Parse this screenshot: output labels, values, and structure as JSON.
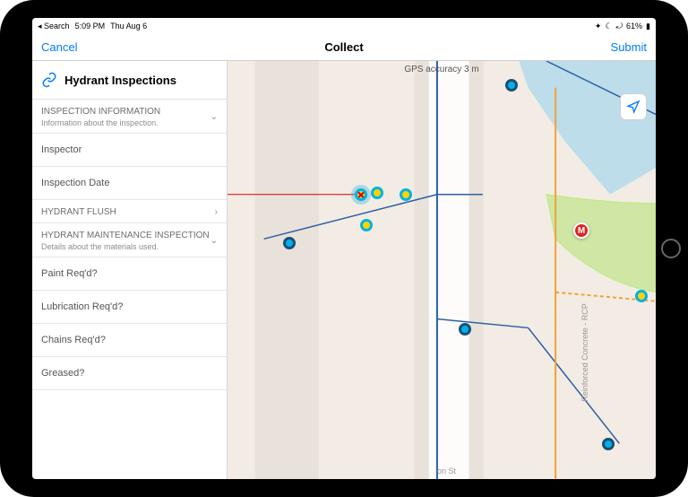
{
  "status": {
    "search": "Search",
    "time": "5:09 PM",
    "date": "Thu Aug 6",
    "battery": "61%"
  },
  "nav": {
    "cancel": "Cancel",
    "title": "Collect",
    "submit": "Submit"
  },
  "form": {
    "title": "Hydrant Inspections",
    "sections": [
      {
        "header": "INSPECTION INFORMATION",
        "desc": "Information about the inspection.",
        "chev": "⌄",
        "fields": [
          "Inspector",
          "Inspection Date"
        ]
      },
      {
        "header": "HYDRANT FLUSH",
        "desc": "",
        "chev": "›",
        "fields": []
      },
      {
        "header": "HYDRANT MAINTENANCE INSPECTION",
        "desc": "Details about the materials used.",
        "chev": "⌄",
        "fields": [
          "Paint Req'd?",
          "Lubrication Req'd?",
          "Chains Req'd?",
          "Greased?"
        ]
      }
    ]
  },
  "map": {
    "gps_label": "GPS accuracy 3 m",
    "street1": "on St",
    "street2": "Reinforced Concrete - RCP",
    "m_label": "M"
  }
}
